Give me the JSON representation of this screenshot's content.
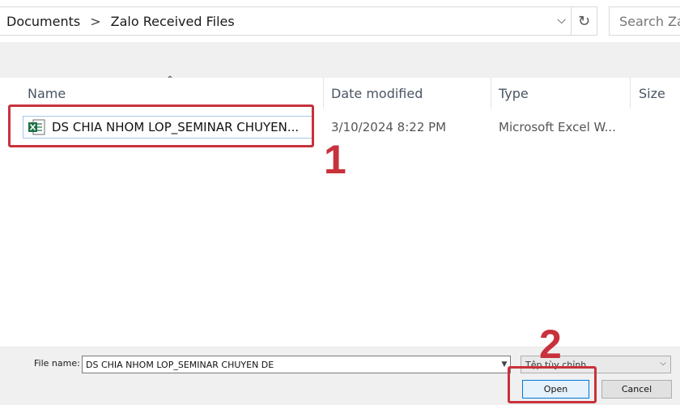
{
  "address_bar": {
    "breadcrumbs": [
      "Documents",
      "Zalo Received Files"
    ],
    "separator": ">",
    "dropdown_glyph": "⌵",
    "refresh_glyph": "↻",
    "search_placeholder": "Search Zalo"
  },
  "columns": {
    "name": "Name",
    "date_modified": "Date modified",
    "type": "Type",
    "size": "Size"
  },
  "files": [
    {
      "icon": "excel-file-icon",
      "name": "DS CHIA NHOM LOP_SEMINAR CHUYEN...",
      "date_modified": "3/10/2024 8:22 PM",
      "type": "Microsoft Excel W..."
    }
  ],
  "annotations": {
    "step1": "1",
    "step2": "2",
    "color": "#c8323c"
  },
  "bottom": {
    "file_name_label": "File name:",
    "file_name_value": "DS CHIA NHOM LOP_SEMINAR CHUYEN DE",
    "file_type_selected": "Tệp tùy chỉnh",
    "open_label": "Open",
    "cancel_label": "Cancel"
  },
  "colors": {
    "selection_border": "#a7c6ea",
    "excel_green": "#1e7145",
    "panel_bg": "#f0f0f0"
  }
}
